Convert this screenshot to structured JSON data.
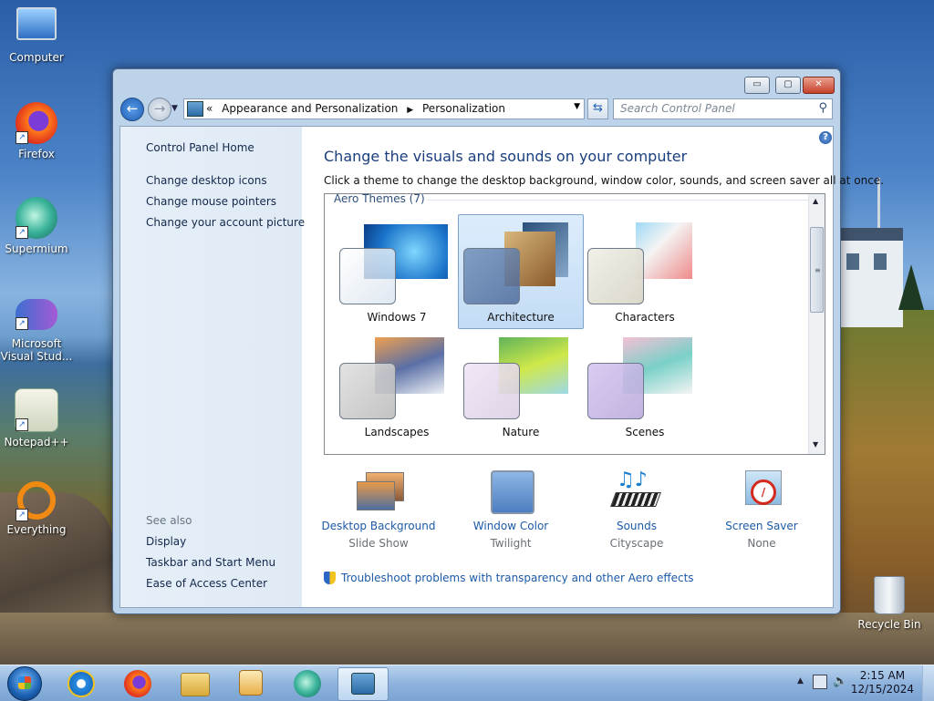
{
  "desktop": {
    "icons": [
      {
        "label": "Computer",
        "icon": "computer-icon"
      },
      {
        "label": "Firefox",
        "icon": "firefox-icon"
      },
      {
        "label": "Supermium",
        "icon": "supermium-icon"
      },
      {
        "label": "Microsoft Visual Stud...",
        "icon": "visual-studio-icon"
      },
      {
        "label": "Notepad++",
        "icon": "notepadpp-icon"
      },
      {
        "label": "Everything",
        "icon": "everything-icon"
      }
    ],
    "recycle_bin": "Recycle Bin"
  },
  "window": {
    "buttons": {
      "minimize": "▭",
      "maximize": "▢",
      "close": "✕"
    },
    "address": {
      "prefix": "«",
      "crumbs": [
        "Appearance and Personalization",
        "Personalization"
      ]
    },
    "search_placeholder": "Search Control Panel",
    "left_pane": {
      "home": "Control Panel Home",
      "links": [
        "Change desktop icons",
        "Change mouse pointers",
        "Change your account picture"
      ],
      "see_also_heading": "See also",
      "see_also": [
        "Display",
        "Taskbar and Start Menu",
        "Ease of Access Center"
      ]
    },
    "main": {
      "title": "Change the visuals and sounds on your computer",
      "subtitle": "Click a theme to change the desktop background, window color, sounds, and screen saver all at once.",
      "group_heading": "Aero Themes (7)",
      "themes": [
        {
          "name": "Windows 7",
          "selected": false
        },
        {
          "name": "Architecture",
          "selected": true
        },
        {
          "name": "Characters",
          "selected": false
        },
        {
          "name": "Landscapes",
          "selected": false
        },
        {
          "name": "Nature",
          "selected": false
        },
        {
          "name": "Scenes",
          "selected": false
        }
      ],
      "settings": [
        {
          "label": "Desktop Background",
          "value": "Slide Show"
        },
        {
          "label": "Window Color",
          "value": "Twilight"
        },
        {
          "label": "Sounds",
          "value": "Cityscape"
        },
        {
          "label": "Screen Saver",
          "value": "None"
        }
      ],
      "troubleshoot": "Troubleshoot problems with transparency and other Aero effects"
    }
  },
  "taskbar": {
    "time": "2:15 AM",
    "date": "12/15/2024"
  }
}
